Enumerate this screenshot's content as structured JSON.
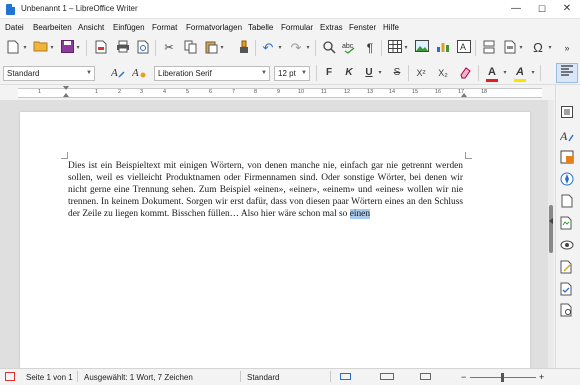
{
  "window": {
    "title": "Unbenannt 1 – LibreOffice Writer",
    "controls": {
      "minimize": "—",
      "maximize": "☐",
      "close": "✕"
    }
  },
  "menubar": [
    "Datei",
    "Bearbeiten",
    "Ansicht",
    "Einfügen",
    "Format",
    "Formatvorlagen",
    "Tabelle",
    "Formular",
    "Extras",
    "Fenster",
    "Hilfe"
  ],
  "formatting": {
    "paragraph_style": "Standard",
    "font_name": "Liberation Serif",
    "font_size": "12 pt",
    "bold": "F",
    "italic": "K",
    "underline": "U",
    "strikethrough": "S",
    "superscript": "X²",
    "subscript": "X₂",
    "font_color_letter": "A",
    "highlight_letter": "A"
  },
  "ruler": {
    "numbers": [
      "1",
      "1",
      "2",
      "3",
      "4",
      "5",
      "6",
      "7",
      "8",
      "9",
      "10",
      "11",
      "12",
      "13",
      "14",
      "15",
      "16",
      "17",
      "18"
    ]
  },
  "document": {
    "text_before": "Dies ist ein Beispieltext mit einigen Wörtern, von denen manche nie, einfach gar nie getrennt werden sollen, weil es vielleicht Produktnamen oder Firmennamen sind. Oder sonstige Wörter, bei denen wir nicht gerne eine Trennung sehen. Zum Beispiel «einen», «einer», «einem» und «eines» wollen wir nie trennen. In keinem Dokument. Sorgen wir erst dafür, dass von diesen paar Wörtern eines an den Schluss der Zeile zu liegen kommt. Bisschen füllen… Also hier wäre schon mal so ",
    "selected_text": "einen"
  },
  "statusbar": {
    "page": "Seite 1 von 1",
    "selection": "Ausgewählt: 1 Wort, 7 Zeichen",
    "page_style": "Standard",
    "zoom_minus": "−",
    "zoom_plus": "+"
  },
  "colors": {
    "accent": "#1f75d6",
    "selection": "#aacbee",
    "font_color_bar": "#e02020",
    "highlight_bar": "#f5e400"
  }
}
